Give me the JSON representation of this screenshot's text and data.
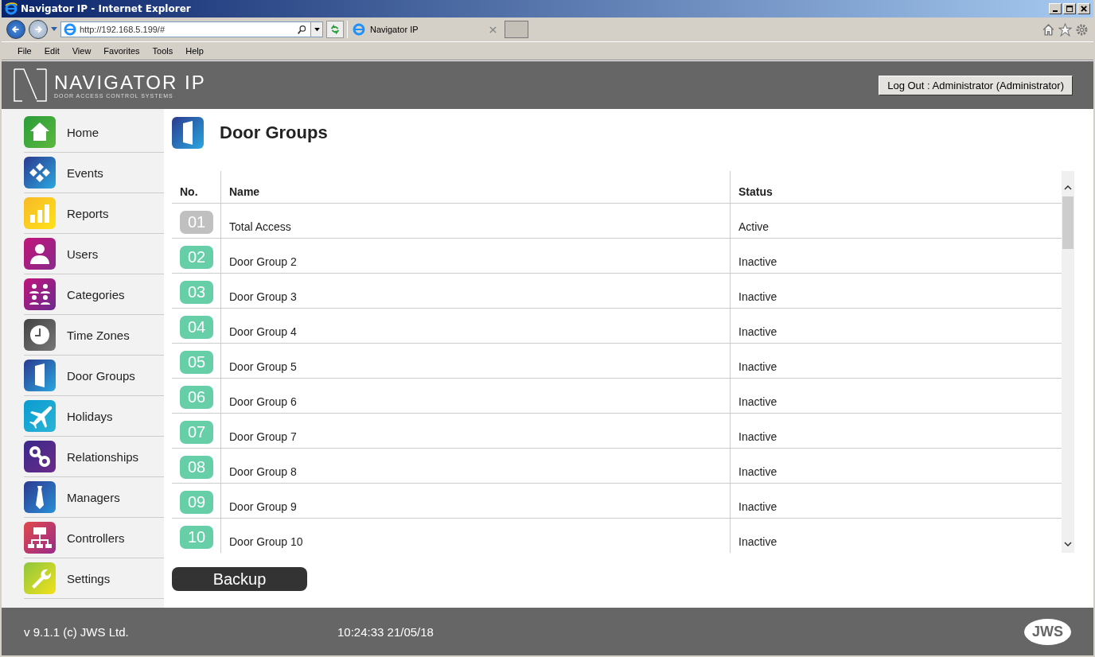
{
  "window": {
    "title": "Navigator IP - Internet Explorer"
  },
  "browser": {
    "address": "http://192.168.5.199/#",
    "tab": "Navigator IP",
    "menu": [
      "File",
      "Edit",
      "View",
      "Favorites",
      "Tools",
      "Help"
    ]
  },
  "header": {
    "logo": "NAVIGATOR IP",
    "tagline": "DOOR ACCESS CONTROL SYSTEMS",
    "logout": "Log Out : Administrator (Administrator)"
  },
  "sidebar": {
    "items": [
      {
        "label": "Home"
      },
      {
        "label": "Events"
      },
      {
        "label": "Reports"
      },
      {
        "label": "Users"
      },
      {
        "label": "Categories"
      },
      {
        "label": "Time Zones"
      },
      {
        "label": "Door Groups"
      },
      {
        "label": "Holidays"
      },
      {
        "label": "Relationships"
      },
      {
        "label": "Managers"
      },
      {
        "label": "Controllers"
      },
      {
        "label": "Settings"
      }
    ]
  },
  "page": {
    "title": "Door Groups"
  },
  "table": {
    "columns": [
      "No.",
      "Name",
      "Status"
    ],
    "rows": [
      {
        "no": "01",
        "color": "#c0c0c0",
        "name": "Total Access",
        "status": "Active"
      },
      {
        "no": "02",
        "color": "#66cfa8",
        "name": "Door Group 2",
        "status": "Inactive"
      },
      {
        "no": "03",
        "color": "#66cfa8",
        "name": "Door Group 3",
        "status": "Inactive"
      },
      {
        "no": "04",
        "color": "#66cfa8",
        "name": "Door Group 4",
        "status": "Inactive"
      },
      {
        "no": "05",
        "color": "#66cfa8",
        "name": "Door Group 5",
        "status": "Inactive"
      },
      {
        "no": "06",
        "color": "#66cfa8",
        "name": "Door Group 6",
        "status": "Inactive"
      },
      {
        "no": "07",
        "color": "#66cfa8",
        "name": "Door Group 7",
        "status": "Inactive"
      },
      {
        "no": "08",
        "color": "#66cfa8",
        "name": "Door Group 8",
        "status": "Inactive"
      },
      {
        "no": "09",
        "color": "#66cfa8",
        "name": "Door Group 9",
        "status": "Inactive"
      },
      {
        "no": "10",
        "color": "#66cfa8",
        "name": "Door Group 10",
        "status": "Inactive"
      }
    ]
  },
  "backup_button": "Backup",
  "footer": {
    "version": "v 9.1.1 (c) JWS Ltd.",
    "datetime": "10:24:33 21/05/18",
    "logo": "JWS"
  }
}
